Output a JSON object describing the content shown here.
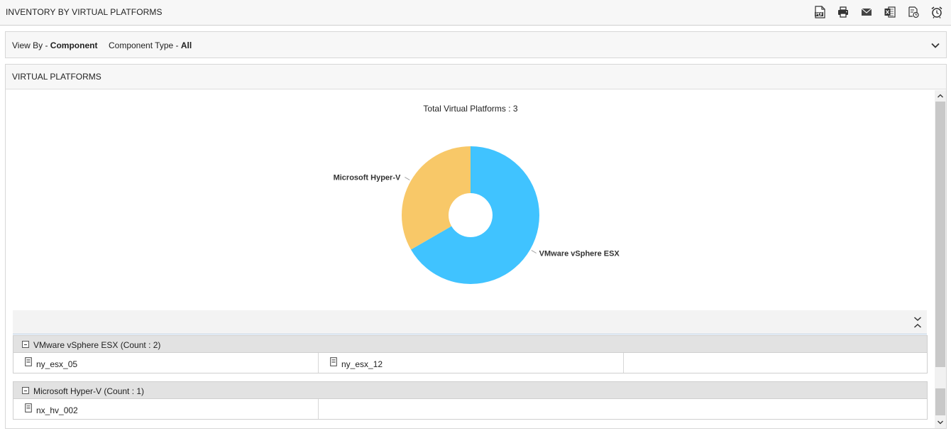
{
  "header": {
    "title": "INVENTORY BY VIRTUAL PLATFORMS"
  },
  "toolbar": {
    "icons": [
      "pdf-icon",
      "print-icon",
      "email-icon",
      "excel-icon",
      "schedule-report-icon",
      "alarm-clock-icon"
    ]
  },
  "filters": {
    "view_by_label": "View By - ",
    "view_by_value": "Component",
    "component_type_label": "Component Type - ",
    "component_type_value": "All"
  },
  "panel": {
    "title": "VIRTUAL PLATFORMS"
  },
  "chart_data": {
    "type": "pie",
    "title": "Total Virtual Platforms : 3",
    "categories": [
      "VMware vSphere ESX",
      "Microsoft Hyper-V"
    ],
    "values": [
      2,
      1
    ],
    "colors": [
      "#40c3ff",
      "#f8c868"
    ],
    "donut": true
  },
  "groups": [
    {
      "title": "VMware vSphere ESX (Count : 2)",
      "items": [
        "ny_esx_05",
        "ny_esx_12"
      ]
    },
    {
      "title": "Microsoft Hyper-V (Count : 1)",
      "items": [
        "nx_hv_002"
      ]
    }
  ]
}
